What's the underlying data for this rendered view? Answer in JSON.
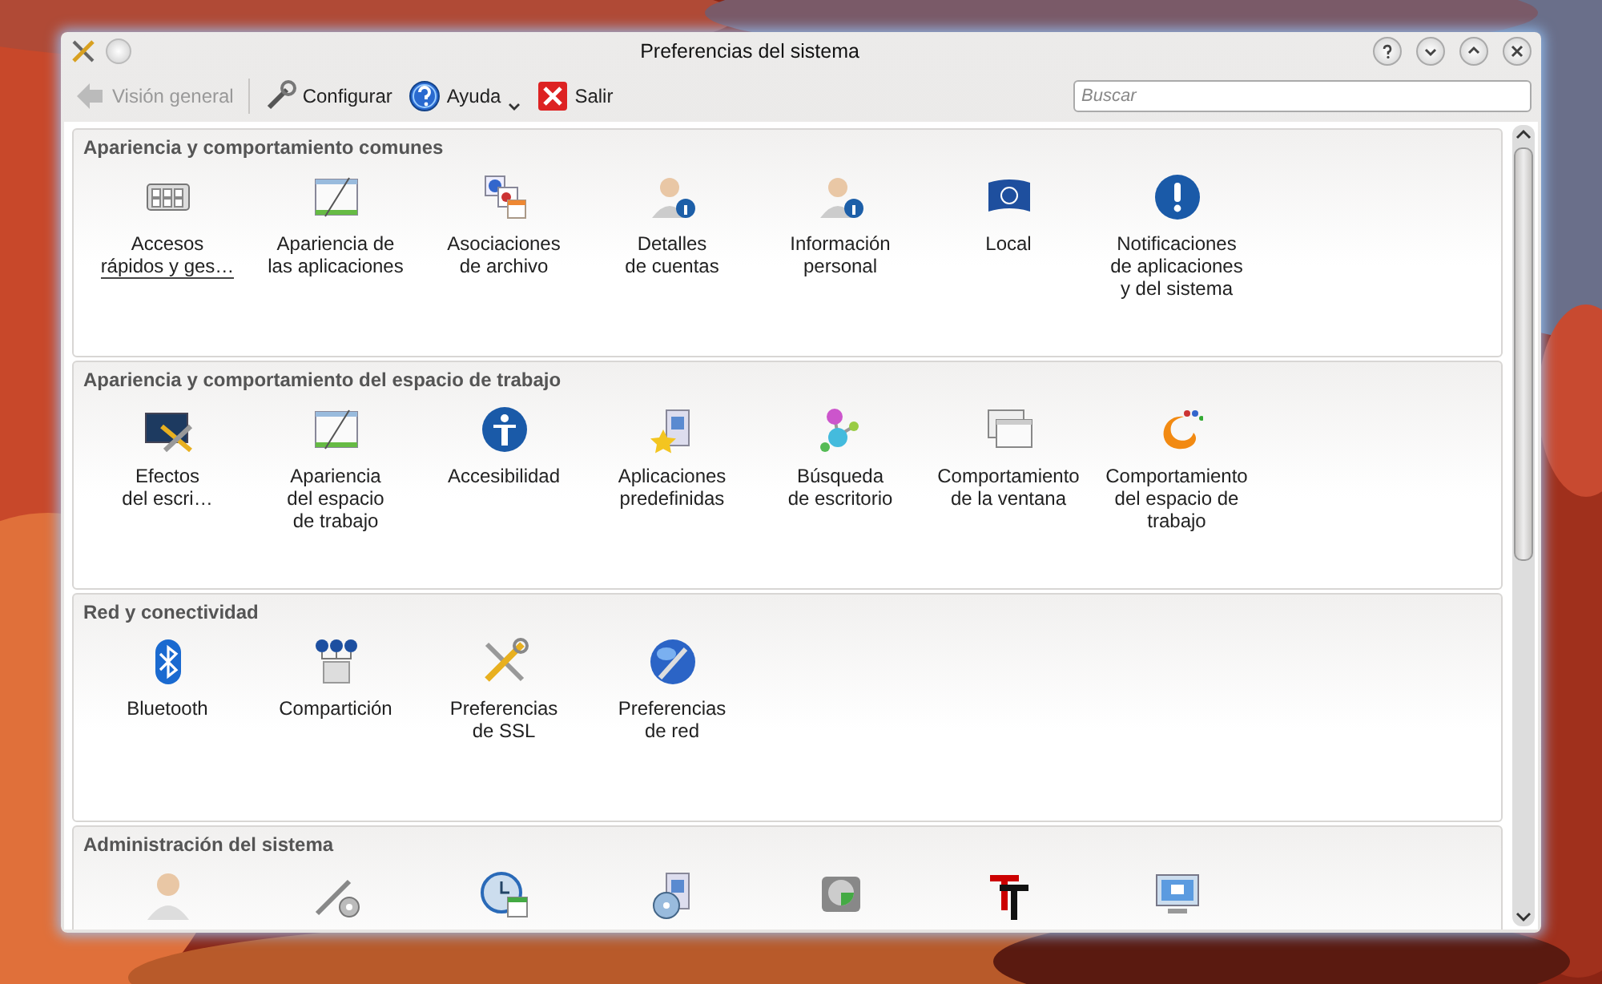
{
  "window": {
    "title": "Preferencias del sistema"
  },
  "toolbar": [
    {
      "label": "Visión general",
      "disabled": true,
      "has_menu": false
    },
    {
      "label": "Configurar",
      "disabled": false,
      "has_menu": false
    },
    {
      "label": "Ayuda",
      "disabled": false,
      "has_menu": true
    },
    {
      "label": "Salir",
      "disabled": false,
      "has_menu": false
    }
  ],
  "search": {
    "placeholder": "Buscar"
  },
  "sections": [
    {
      "title": "Apariencia y comportamiento comunes",
      "items": [
        {
          "label": "Accesos\nrápidos y ges…",
          "selected": true
        },
        {
          "label": "Apariencia de\nlas aplicaciones",
          "selected": false
        },
        {
          "label": "Asociaciones\nde archivo",
          "selected": false
        },
        {
          "label": "Detalles\nde cuentas",
          "selected": false
        },
        {
          "label": "Información\npersonal",
          "selected": false
        },
        {
          "label": "Local",
          "selected": false
        },
        {
          "label": "Notificaciones\nde aplicaciones\ny del sistema",
          "selected": false
        }
      ]
    },
    {
      "title": "Apariencia y comportamiento del espacio de trabajo",
      "items": [
        {
          "label": "Efectos\ndel escri…",
          "selected": false
        },
        {
          "label": "Apariencia\ndel espacio\nde trabajo",
          "selected": false
        },
        {
          "label": "Accesibilidad",
          "selected": false
        },
        {
          "label": "Aplicaciones\npredefinidas",
          "selected": false
        },
        {
          "label": "Búsqueda\nde escritorio",
          "selected": false
        },
        {
          "label": "Comportamiento\nde la ventana",
          "selected": false
        },
        {
          "label": "Comportamiento\ndel espacio de\ntrabajo",
          "selected": false
        }
      ]
    },
    {
      "title": "Red y conectividad",
      "items": [
        {
          "label": "Bluetooth",
          "selected": false
        },
        {
          "label": "Compartición",
          "selected": false
        },
        {
          "label": "Preferencias\nde SSL",
          "selected": false
        },
        {
          "label": "Preferencias\nde red",
          "selected": false
        }
      ]
    },
    {
      "title": "Administración del sistema",
      "items": [
        {
          "selected": false
        },
        {
          "selected": false
        },
        {
          "selected": false
        },
        {
          "selected": false
        },
        {
          "selected": false
        },
        {
          "selected": false
        },
        {
          "selected": false
        }
      ]
    }
  ]
}
